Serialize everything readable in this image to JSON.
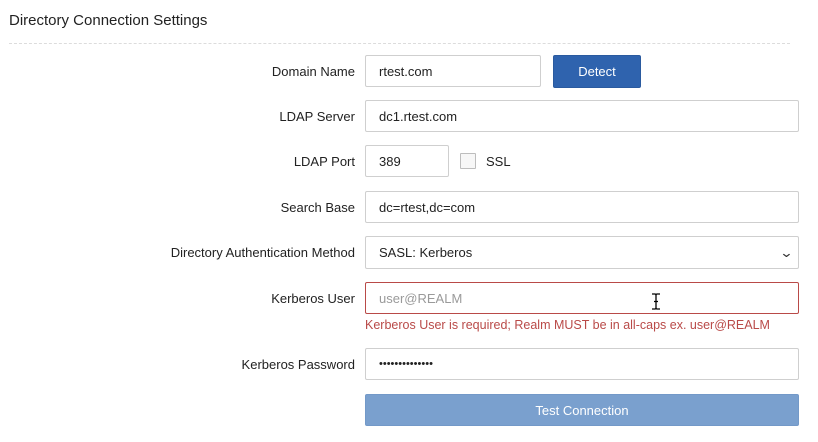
{
  "section": {
    "title": "Directory Connection Settings"
  },
  "form": {
    "domain_name": {
      "label": "Domain Name",
      "value": "rtest.com"
    },
    "detect_button": "Detect",
    "ldap_server": {
      "label": "LDAP Server",
      "value": "dc1.rtest.com"
    },
    "ldap_port": {
      "label": "LDAP Port",
      "value": "389"
    },
    "ssl": {
      "label": "SSL",
      "checked": false
    },
    "search_base": {
      "label": "Search Base",
      "value": "dc=rtest,dc=com"
    },
    "auth_method": {
      "label": "Directory Authentication Method",
      "selected": "SASL: Kerberos"
    },
    "kerberos_user": {
      "label": "Kerberos User",
      "value": "",
      "placeholder": "user@REALM",
      "error": "Kerberos User is required; Realm MUST be in all-caps ex. user@REALM"
    },
    "kerberos_password": {
      "label": "Kerberos Password",
      "value": "••••••••••••••"
    },
    "test_button": "Test Connection"
  },
  "colors": {
    "primary_button": "#2f63ae",
    "disabled_button": "#7aa0ce",
    "error": "#b94a48"
  },
  "icons": {
    "select_caret": "chevron-down-icon",
    "mouse_cursor": "text-cursor-icon"
  }
}
